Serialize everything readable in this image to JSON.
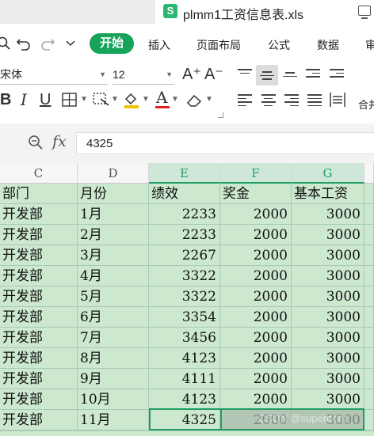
{
  "titlebar": {
    "logo": "S",
    "filename": "plmm1工资信息表.xls",
    "window_icon": "monitor-icon"
  },
  "menubar": {
    "icons": [
      "search-icon",
      "undo-icon",
      "redo-icon",
      "chevron-down-icon"
    ],
    "start": "开始",
    "tabs": [
      "插入",
      "页面布局",
      "公式",
      "数据",
      "审"
    ]
  },
  "toolbar": {
    "font_name": "宋体",
    "font_size": "12",
    "grow_font": "A⁺",
    "shrink_font": "A⁻",
    "bold": "B",
    "italic": "I",
    "underline": "U",
    "merge_label": "合并"
  },
  "formula": {
    "value": "4325"
  },
  "colors": {
    "accent": "#17a35b",
    "cell_fill": "#cce8cf",
    "selection": "#1e9e62"
  },
  "grid": {
    "columns": [
      "C",
      "D",
      "E",
      "F",
      "G"
    ],
    "header_row": [
      "部门",
      "月份",
      "绩效",
      "奖金",
      "基本工资"
    ],
    "rows": [
      [
        "开发部",
        "1月",
        "2233",
        "2000",
        "3000"
      ],
      [
        "开发部",
        "2月",
        "2233",
        "2000",
        "3000"
      ],
      [
        "开发部",
        "3月",
        "2267",
        "2000",
        "3000"
      ],
      [
        "开发部",
        "4月",
        "3322",
        "2000",
        "3000"
      ],
      [
        "开发部",
        "5月",
        "3322",
        "2000",
        "3000"
      ],
      [
        "开发部",
        "6月",
        "3354",
        "2000",
        "3000"
      ],
      [
        "开发部",
        "7月",
        "3456",
        "2000",
        "3000"
      ],
      [
        "开发部",
        "8月",
        "4123",
        "2000",
        "3000"
      ],
      [
        "开发部",
        "9月",
        "4111",
        "2000",
        "3000"
      ],
      [
        "开发部",
        "10月",
        "4123",
        "2000",
        "3000"
      ],
      [
        "开发部",
        "11月",
        "4325",
        "2000",
        "3000"
      ]
    ],
    "watermark": "CSDN @superdont"
  }
}
